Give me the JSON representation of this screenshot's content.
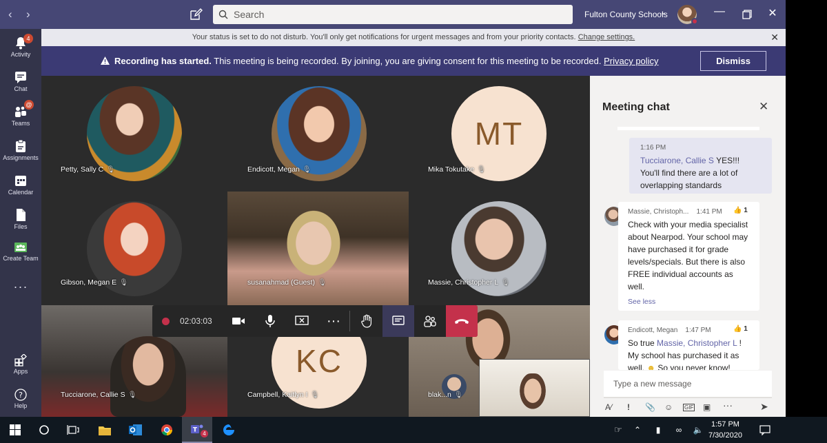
{
  "titlebar": {
    "search_placeholder": "Search",
    "org_name": "Fulton County Schools"
  },
  "rail": [
    {
      "label": "Activity",
      "icon": "bell-icon",
      "badge": "4"
    },
    {
      "label": "Chat",
      "icon": "chat-icon"
    },
    {
      "label": "Teams",
      "icon": "teams-icon",
      "badge": "@"
    },
    {
      "label": "Assignments",
      "icon": "assignments-icon"
    },
    {
      "label": "Calendar",
      "icon": "calendar-icon"
    },
    {
      "label": "Files",
      "icon": "files-icon"
    },
    {
      "label": "Create Team",
      "icon": "create-team-icon"
    },
    {
      "label": "Apps",
      "icon": "apps-icon"
    },
    {
      "label": "Help",
      "icon": "help-icon"
    }
  ],
  "dnd_banner": {
    "text": "Your status is set to do not disturb. You'll only get notifications for urgent messages and from your priority contacts.",
    "link": "Change settings."
  },
  "recording_banner": {
    "bold": "Recording has started.",
    "text": "This meeting is being recorded. By joining, you are giving consent for this meeting to be recorded.",
    "link": "Privacy policy",
    "dismiss": "Dismiss"
  },
  "participants": [
    {
      "name": "Petty, Sally C"
    },
    {
      "name": "Endicott, Megan"
    },
    {
      "name": "Mika Tokutake",
      "initials": "MT"
    },
    {
      "name": "Gibson, Megan E"
    },
    {
      "name": "susanahmad (Guest)"
    },
    {
      "name": "Massie, Christopher L"
    },
    {
      "name": "Tucciarone, Callie S"
    },
    {
      "name": "Campbell, Kaitlyn I",
      "initials": "KC"
    },
    {
      "name": "blak...n"
    }
  ],
  "toolbar": {
    "timer": "02:03:03"
  },
  "chat": {
    "title": "Meeting chat",
    "messages": [
      {
        "time": "1:16 PM",
        "mention": "Tucciarone, Callie S",
        "text": "YES!!! You'll find there are a lot of overlapping standards"
      },
      {
        "author": "Massie, Christoph...",
        "time": "1:41 PM",
        "likes": "1",
        "text": "Check with your media specialist about Nearpod. Your school may have purchased it for grade levels/specials. But there is also FREE individual accounts as well.",
        "see_less": "See less"
      },
      {
        "author": "Endicott, Megan",
        "time": "1:47 PM",
        "likes": "1",
        "text_pre": "So true",
        "mention": "Massie, Christopher L",
        "text_post": "! My school has purchased it as well.",
        "text_end": "So you never know!"
      }
    ],
    "input_placeholder": "Type a new message"
  },
  "taskbar": {
    "time": "1:57 PM",
    "date": "7/30/2020",
    "teams_badge": "4"
  }
}
